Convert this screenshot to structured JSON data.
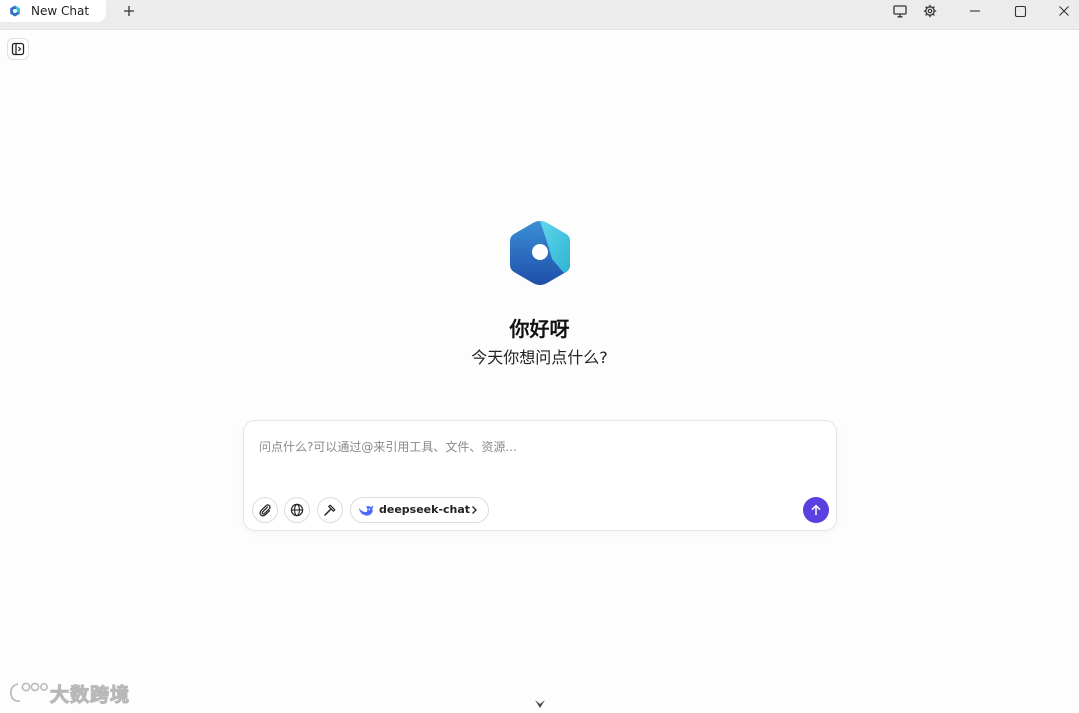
{
  "tabs": [
    {
      "label": "New Chat",
      "icon": "app-logo-icon"
    }
  ],
  "titlebar": {
    "new_tab_icon": "plus-icon",
    "actions": [
      "monitor-icon",
      "gear-icon"
    ],
    "window_controls": [
      "minimize-icon",
      "maximize-icon",
      "close-icon"
    ]
  },
  "sidebar_toggle": {
    "icon": "sidebar-toggle-icon"
  },
  "hero": {
    "greeting": "你好呀",
    "subtitle": "今天你想问点什么?"
  },
  "composer": {
    "placeholder": "问点什么?可以通过@来引用工具、文件、资源...",
    "value": "",
    "tools": [
      "paperclip-icon",
      "globe-icon",
      "hammer-icon"
    ],
    "model": {
      "label": "deepseek-chat",
      "icon": "deepseek-whale-icon"
    },
    "send_icon": "arrow-up-icon"
  },
  "watermark": {
    "text": "大数跨境"
  },
  "colors": {
    "accent": "#5b3fe0",
    "logo_primary": "#2f6fc7",
    "logo_secondary": "#3fc0dc",
    "deepseek_blue": "#4d6bfe"
  }
}
